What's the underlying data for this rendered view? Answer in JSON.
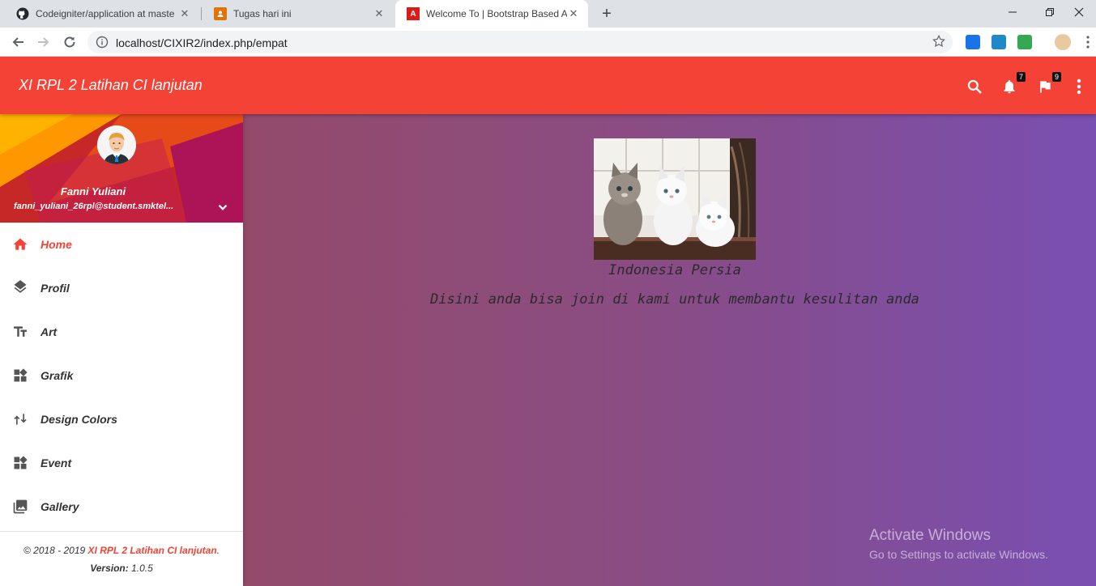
{
  "browser": {
    "tabs": [
      {
        "title": "Codeigniter/application at maste",
        "icon": "github-icon"
      },
      {
        "title": "Tugas hari ini",
        "icon": "classroom-icon"
      },
      {
        "title": "Welcome To | Bootstrap Based A",
        "icon": "angular-a-icon"
      }
    ],
    "url": "localhost/CIXIR2/index.php/empat"
  },
  "app": {
    "brand": "XI RPL 2 Latihan CI lanjutan",
    "notifications_count": "7",
    "flags_count": "9"
  },
  "user": {
    "name": "Fanni Yuliani",
    "email": "fanni_yuliani_26rpl@student.smktel..."
  },
  "sidebar": {
    "items": [
      {
        "label": "Home",
        "icon": "home-icon",
        "active": true
      },
      {
        "label": "Profil",
        "icon": "layers-icon"
      },
      {
        "label": "Art",
        "icon": "text-fields-icon"
      },
      {
        "label": "Grafik",
        "icon": "widgets-icon"
      },
      {
        "label": "Design Colors",
        "icon": "swap-vert-icon"
      },
      {
        "label": "Event",
        "icon": "widgets-icon"
      },
      {
        "label": "Gallery",
        "icon": "photo-library-icon"
      }
    ]
  },
  "footer": {
    "copyright_prefix": "© 2018 - 2019 ",
    "copyright_link": "XI RPL 2 Latihan CI lanjutan",
    "copyright_suffix": ".",
    "version_label": "Version:",
    "version_value": " 1.0.5"
  },
  "main": {
    "image_alt": "three kittens",
    "caption": "Indonesia Persia",
    "tagline": "Disini anda bisa join di kami untuk membantu kesulitan anda"
  },
  "watermark": {
    "line1": "Activate Windows",
    "line2": "Go to Settings to activate Windows."
  },
  "colors": {
    "accent": "#f44336",
    "content_gradient_start": "#944b6a",
    "content_gradient_end": "#794fb1"
  }
}
